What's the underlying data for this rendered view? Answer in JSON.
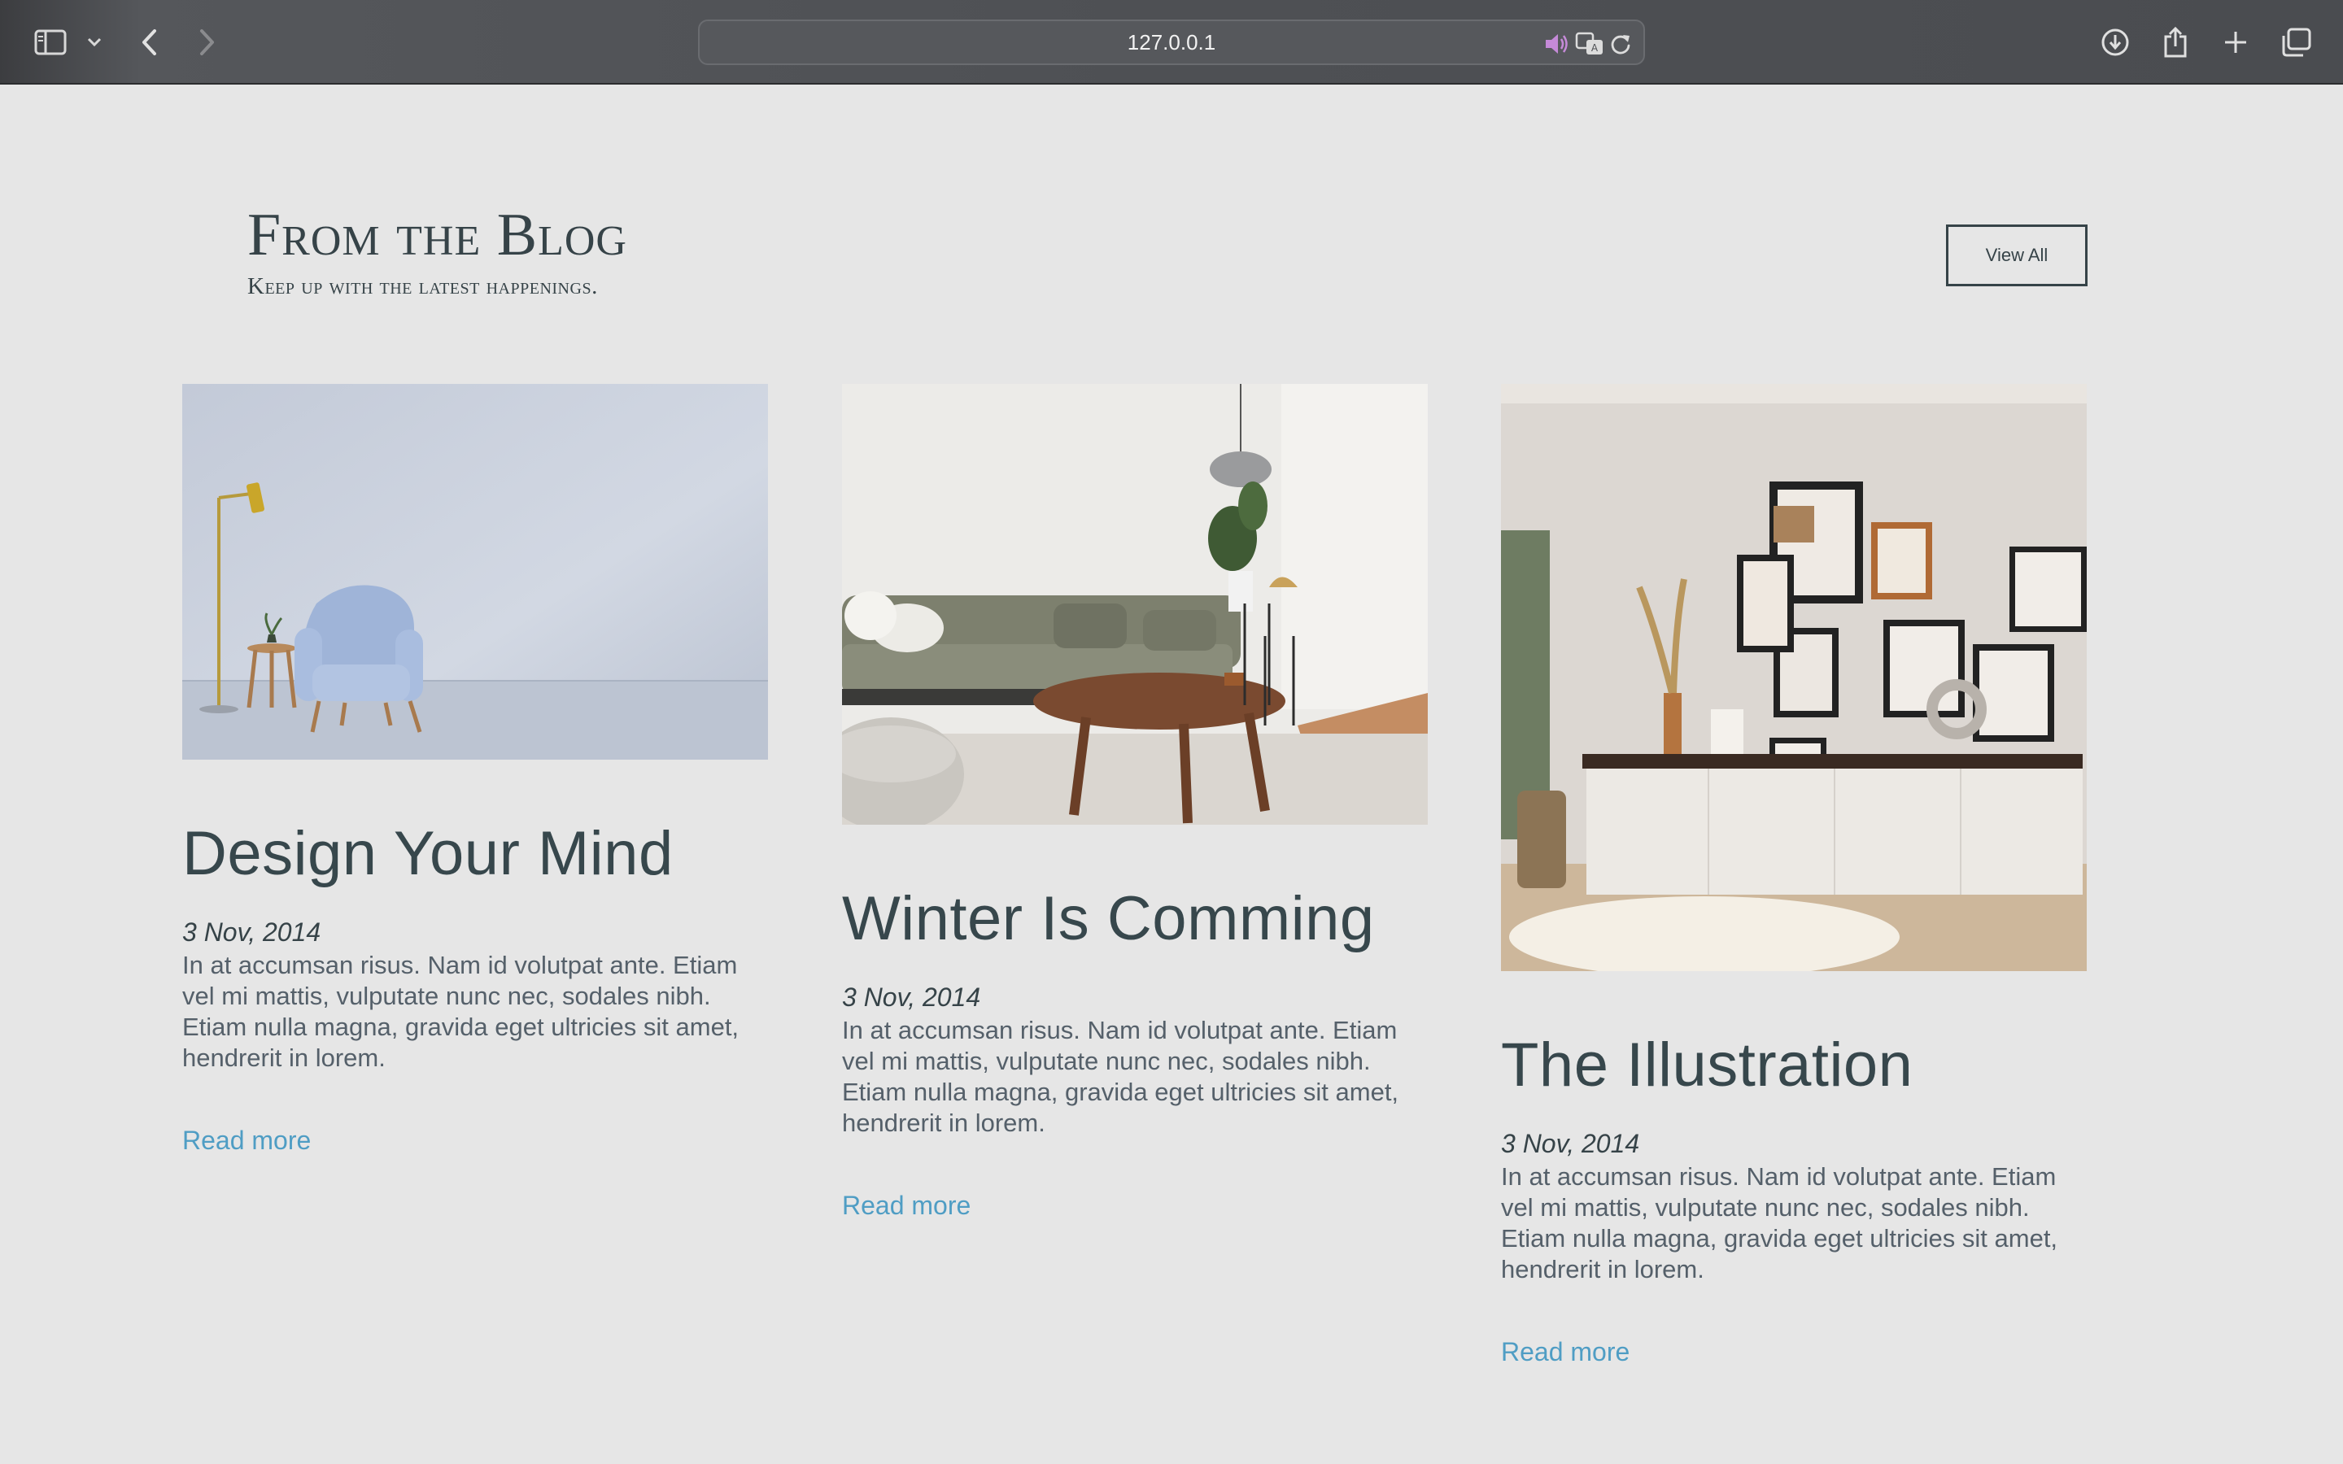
{
  "browser": {
    "url": "127.0.0.1"
  },
  "section": {
    "title": "From the Blog",
    "subtitle": "Keep up with the latest happenings.",
    "view_all_label": "View All"
  },
  "posts": [
    {
      "title": "Design Your Mind",
      "date": "3 Nov, 2014",
      "excerpt": "In at accumsan risus. Nam id volutpat ante. Etiam vel mi mattis, vulputate nunc nec, sodales nibh. Etiam nulla magna, gravida eget ultricies sit amet, hendrerit in lorem.",
      "link_label": "Read more"
    },
    {
      "title": "Winter Is Comming",
      "date": "3 Nov, 2014",
      "excerpt": "In at accumsan risus. Nam id volutpat ante. Etiam vel mi mattis, vulputate nunc nec, sodales nibh. Etiam nulla magna, gravida eget ultricies sit amet, hendrerit in lorem.",
      "link_label": "Read more"
    },
    {
      "title": "The Illustration",
      "date": "3 Nov, 2014",
      "excerpt": "In at accumsan risus. Nam id volutpat ante. Etiam vel mi mattis, vulputate nunc nec, sodales nibh. Etiam nulla magna, gravida eget ultricies sit amet, hendrerit in lorem.",
      "link_label": "Read more"
    }
  ],
  "colors": {
    "page_background": "#e6e6e6",
    "heading": "#364348",
    "link": "#4f9dc4",
    "body_text": "#55606a"
  }
}
